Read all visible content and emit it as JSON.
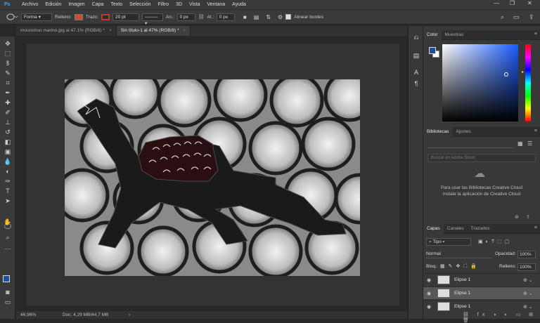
{
  "menubar": {
    "logo": "Ps",
    "items": [
      "Archivo",
      "Edición",
      "Imagen",
      "Capa",
      "Texto",
      "Selección",
      "Filtro",
      "3D",
      "Vista",
      "Ventana",
      "Ayuda"
    ],
    "window_buttons": [
      "—",
      "❐",
      "✕"
    ]
  },
  "options": {
    "mode": "Forma",
    "fill_label": "Relleno:",
    "stroke_label": "Trazo:",
    "stroke_width": "20 pt",
    "width_label": "An.:",
    "width_value": "0 px",
    "height_label": "Al.:",
    "height_value": "0 px",
    "align_label": "Alinear bordes",
    "fill_color": "#c8502a",
    "stroke_color": "#c0392b"
  },
  "tabs": [
    {
      "label": "mounstruo marino.jpg al 47.1% (RGB/8) *",
      "close": "×"
    },
    {
      "label": "Sin título-1 al 47% (RGB/8) *",
      "close": "×"
    }
  ],
  "status": {
    "zoom": "46,96%",
    "doc": "Doc: 4,29 MB/44,7 MB",
    "arrow": "›"
  },
  "color_panel": {
    "tabs": [
      "Color",
      "Muestras"
    ],
    "fg": "#1d4fa0",
    "bg": "#ffffff"
  },
  "libraries": {
    "tabs": [
      "Bibliotecas",
      "Ajustes"
    ],
    "search_placeholder": "Buscar en Adobe Stock",
    "message": "Para usar las Bibliotecas Creative Cloud instale la aplicación de Creative Cloud"
  },
  "layers": {
    "tabs": [
      "Capas",
      "Canales",
      "Trazados"
    ],
    "kind": "Tipo",
    "blend": "Normal",
    "opacity_label": "Opacidad:",
    "opacity": "100%",
    "lock_label": "Bloq.:",
    "fill_label": "Relleno:",
    "fill": "100%",
    "items": [
      {
        "name": "Elipse 1",
        "selected": false
      },
      {
        "name": "Elipse 1",
        "selected": true
      },
      {
        "name": "Elipse 1",
        "selected": false
      }
    ]
  }
}
